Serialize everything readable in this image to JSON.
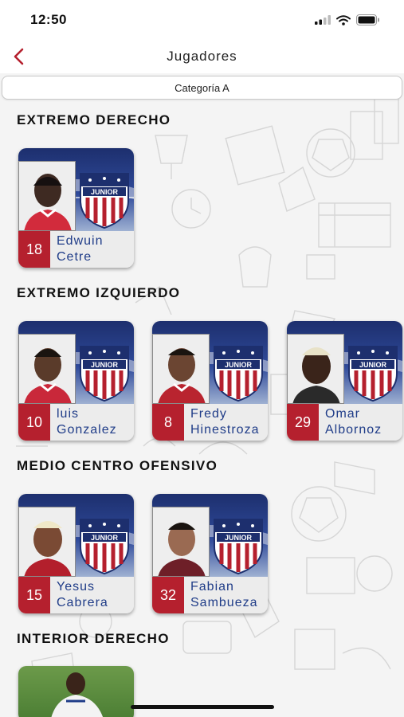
{
  "status": {
    "time": "12:50"
  },
  "header": {
    "title": "Jugadores"
  },
  "filter": {
    "selected": "Categoría A"
  },
  "sections": [
    {
      "title": "EXTREMO DERECHO",
      "players": [
        {
          "number": "18",
          "first": "Edwuin",
          "last": "Cetre"
        }
      ]
    },
    {
      "title": "EXTREMO IZQUIERDO",
      "players": [
        {
          "number": "10",
          "first": "luis",
          "last": "Gonzalez"
        },
        {
          "number": "8",
          "first": "Fredy",
          "last": "Hinestroza"
        },
        {
          "number": "29",
          "first": "Omar",
          "last": "Albornoz"
        }
      ]
    },
    {
      "title": "MEDIO CENTRO OFENSIVO",
      "players": [
        {
          "number": "15",
          "first": "Yesus",
          "last": "Cabrera"
        },
        {
          "number": "32",
          "first": "Fabian",
          "last": "Sambueza"
        }
      ]
    },
    {
      "title": "INTERIOR DERECHO",
      "players": []
    }
  ],
  "crest_text": "JUNIOR",
  "colors": {
    "accent": "#b5202e",
    "name": "#1f3c88",
    "crest_blue": "#1d2f6e"
  },
  "icons": [
    "back-chevron-icon",
    "cellular-signal-icon",
    "wifi-icon",
    "battery-icon"
  ]
}
